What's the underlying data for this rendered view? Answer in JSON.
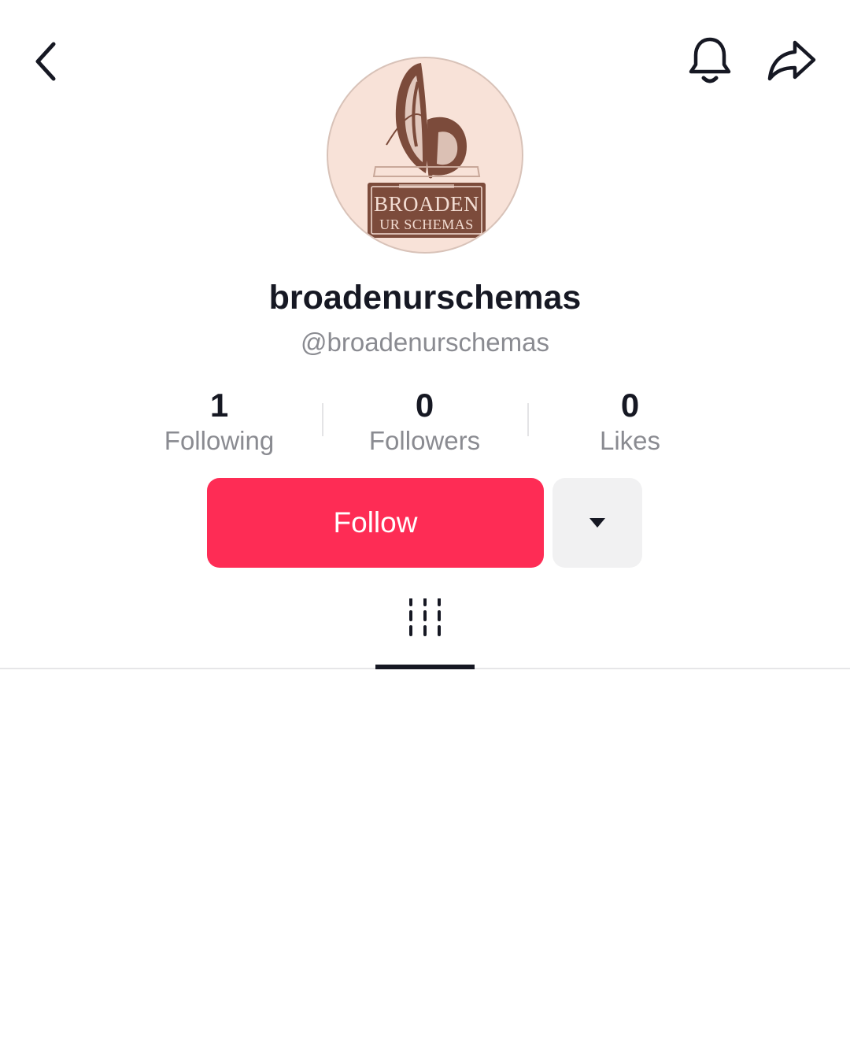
{
  "header": {
    "back_icon": "chevron-left-icon",
    "bell_icon": "bell-icon",
    "share_icon": "share-arrow-icon"
  },
  "profile": {
    "avatar_logo_line1": "BROADEN",
    "avatar_logo_line2": "UR SCHEMAS",
    "display_name": "broadenurschemas",
    "handle": "@broadenurschemas"
  },
  "stats": [
    {
      "value": "1",
      "label": "Following"
    },
    {
      "value": "0",
      "label": "Followers"
    },
    {
      "value": "0",
      "label": "Likes"
    }
  ],
  "actions": {
    "follow_label": "Follow",
    "more_icon": "caret-down-icon"
  },
  "tabs": {
    "videos_icon": "video-grid-icon"
  },
  "colors": {
    "accent": "#fe2c55",
    "avatar_bg": "#f8e2d8",
    "avatar_logo": "#7c4b3b"
  }
}
